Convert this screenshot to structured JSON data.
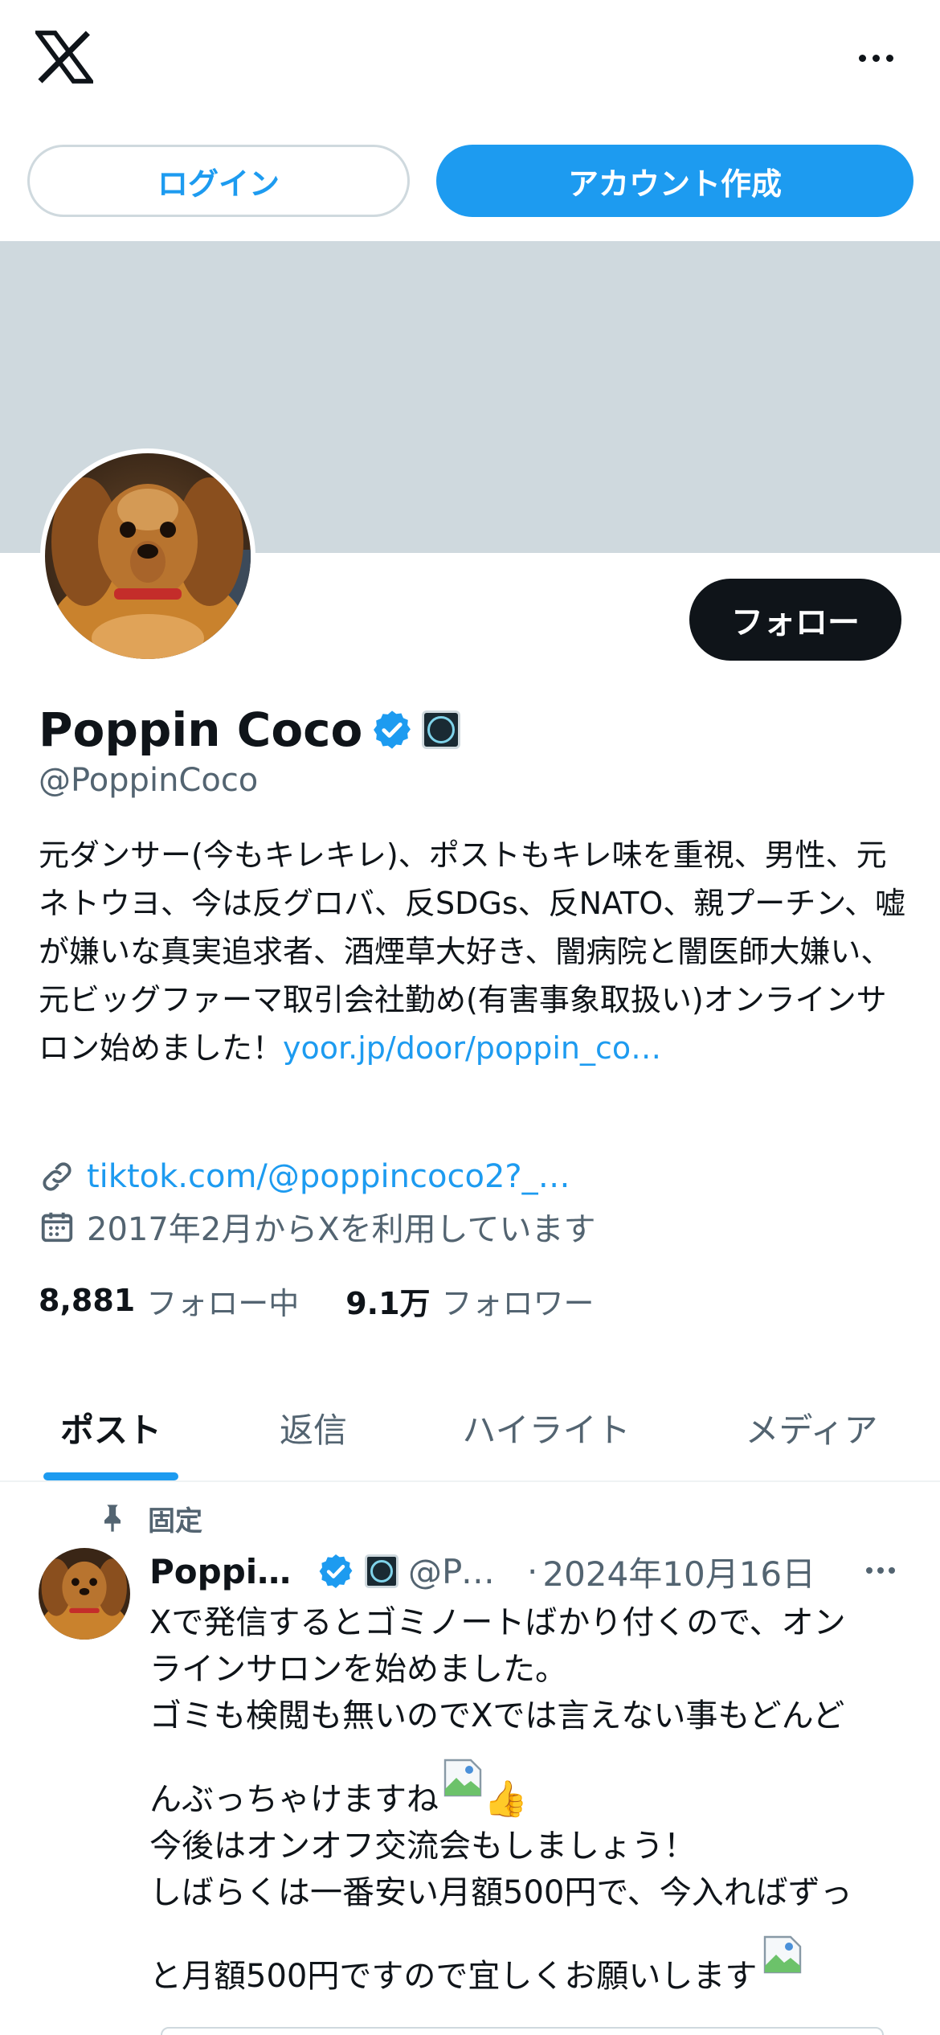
{
  "topbar": {
    "logo_icon": "x-logo-icon",
    "more_icon": "more-horizontal-icon"
  },
  "auth": {
    "login_label": "ログイン",
    "signup_label": "アカウント作成"
  },
  "profile": {
    "follow_label": "フォロー",
    "display_name": "Poppin Coco",
    "handle": "@PoppinCoco",
    "bio_text": "元ダンサー(今もキレキレ)、ポストもキレ味を重視、男性、元ネトウヨ、今は反グロバ、反SDGs、反NATO、親プーチン、嘘が嫌いな真実追求者、酒煙草大好き、闇病院と闇医師大嫌い、元ビッグファーマ取引会社勤め(有害事象取扱い)オンラインサロン始めました！",
    "bio_link": "yoor.jp/door/poppin_co…",
    "website": "tiktok.com/@poppincoco2?_…",
    "joined": "2017年2月からXを利用しています",
    "following_count": "8,881",
    "following_label": "フォロー中",
    "followers_count": "9.1万",
    "followers_label": "フォロワー"
  },
  "tabs": [
    {
      "label": "ポスト",
      "active": true
    },
    {
      "label": "返信",
      "active": false
    },
    {
      "label": "ハイライト",
      "active": false
    },
    {
      "label": "メディア",
      "active": false
    }
  ],
  "post": {
    "pinned_label": "固定",
    "author_name": "Poppi…",
    "author_handle": "@Po…",
    "separator": "·",
    "date": "2024年10月16日",
    "lines": [
      "Xで発信するとゴミノートばかり付くので、オン",
      "ラインサロンを始めました。",
      "ゴミも検閲も無いのでXでは言えない事もどんど",
      "んぶっちゃけますね",
      "今後はオンオフ交流会もしましょう！",
      "しばらくは一番安い月額500円で、今入ればずっ",
      "と月額500円ですので宜しくお願いします"
    ],
    "emoji": "👍"
  },
  "colors": {
    "accent": "#1d9bf0",
    "text": "#0f1419",
    "muted": "#536471",
    "banner": "#cfd9de"
  }
}
